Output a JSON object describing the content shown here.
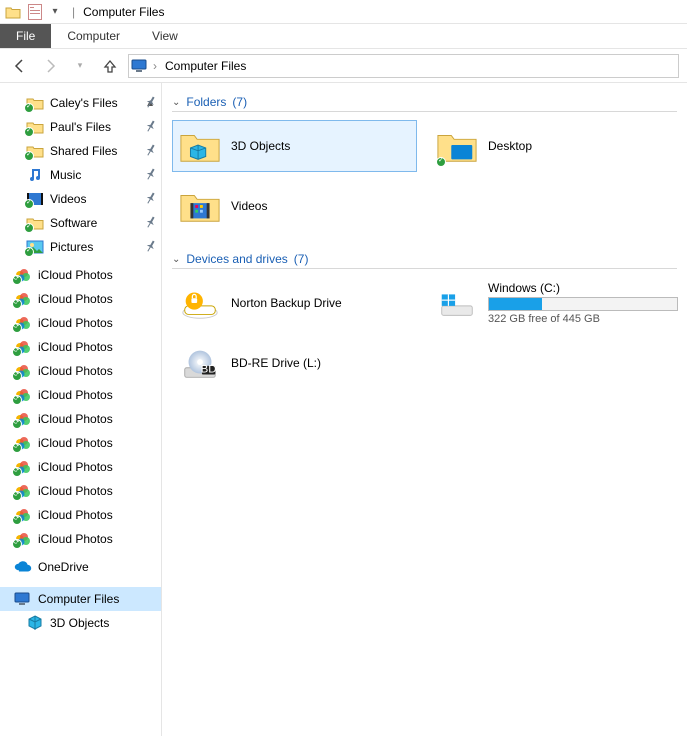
{
  "window": {
    "title": "Computer Files"
  },
  "menu": {
    "file": "File",
    "computer": "Computer",
    "view": "View"
  },
  "breadcrumb": {
    "root_label": "Computer Files"
  },
  "sidebar": {
    "pinned": [
      {
        "label": "Caley's Files",
        "icon": "folder-green"
      },
      {
        "label": "Paul's Files",
        "icon": "folder-green"
      },
      {
        "label": "Shared Files",
        "icon": "folder-green"
      },
      {
        "label": "Music",
        "icon": "music"
      },
      {
        "label": "Videos",
        "icon": "video"
      },
      {
        "label": "Software",
        "icon": "folder-green"
      },
      {
        "label": "Pictures",
        "icon": "pictures"
      }
    ],
    "icloud_count": 12,
    "icloud_label": "iCloud Photos",
    "onedrive_label": "OneDrive",
    "computer_files_label": "Computer Files",
    "three_d_label": "3D Objects"
  },
  "sections": {
    "folders": {
      "title": "Folders",
      "count": "(7)"
    },
    "drives": {
      "title": "Devices and drives",
      "count": "(7)"
    }
  },
  "folders": [
    {
      "label": "3D Objects",
      "selected": true
    },
    {
      "label": "Desktop"
    },
    {
      "label": "Videos"
    }
  ],
  "drives": {
    "norton": {
      "label": "Norton Backup Drive"
    },
    "windows": {
      "label": "Windows (C:)",
      "subtitle": "322 GB free of 445 GB",
      "used_pct": 28
    },
    "bdre": {
      "label": "BD-RE Drive (L:)"
    }
  }
}
